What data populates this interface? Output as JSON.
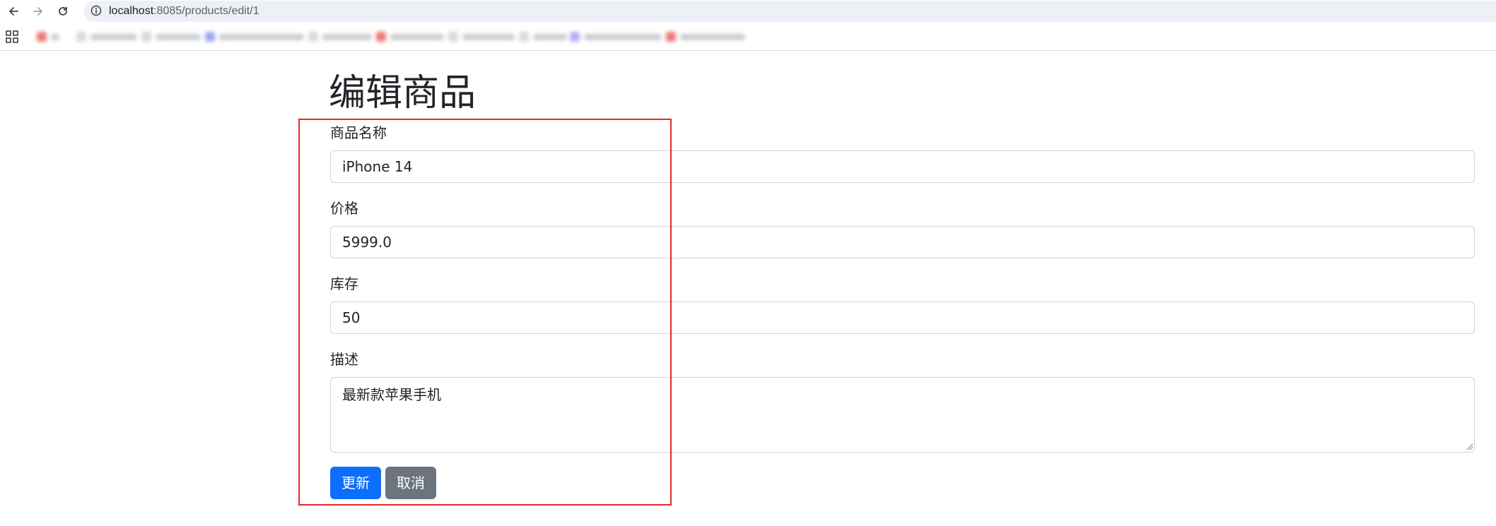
{
  "browser": {
    "url_host": "localhost",
    "url_path": ":8085/products/edit/1",
    "icons": {
      "back": "arrow-left-icon",
      "forward": "arrow-right-icon",
      "reload": "reload-icon",
      "site_info": "info-icon",
      "apps": "apps-grid-icon"
    }
  },
  "page": {
    "title": "编辑商品"
  },
  "form": {
    "name": {
      "label": "商品名称",
      "value": "iPhone 14"
    },
    "price": {
      "label": "价格",
      "value": "5999.0"
    },
    "stock": {
      "label": "库存",
      "value": "50"
    },
    "description": {
      "label": "描述",
      "value": "最新款苹果手机"
    },
    "submit_label": "更新",
    "cancel_label": "取消"
  },
  "colors": {
    "primary": "#0d6efd",
    "secondary": "#6c757d",
    "highlight": "#e52b2b"
  }
}
